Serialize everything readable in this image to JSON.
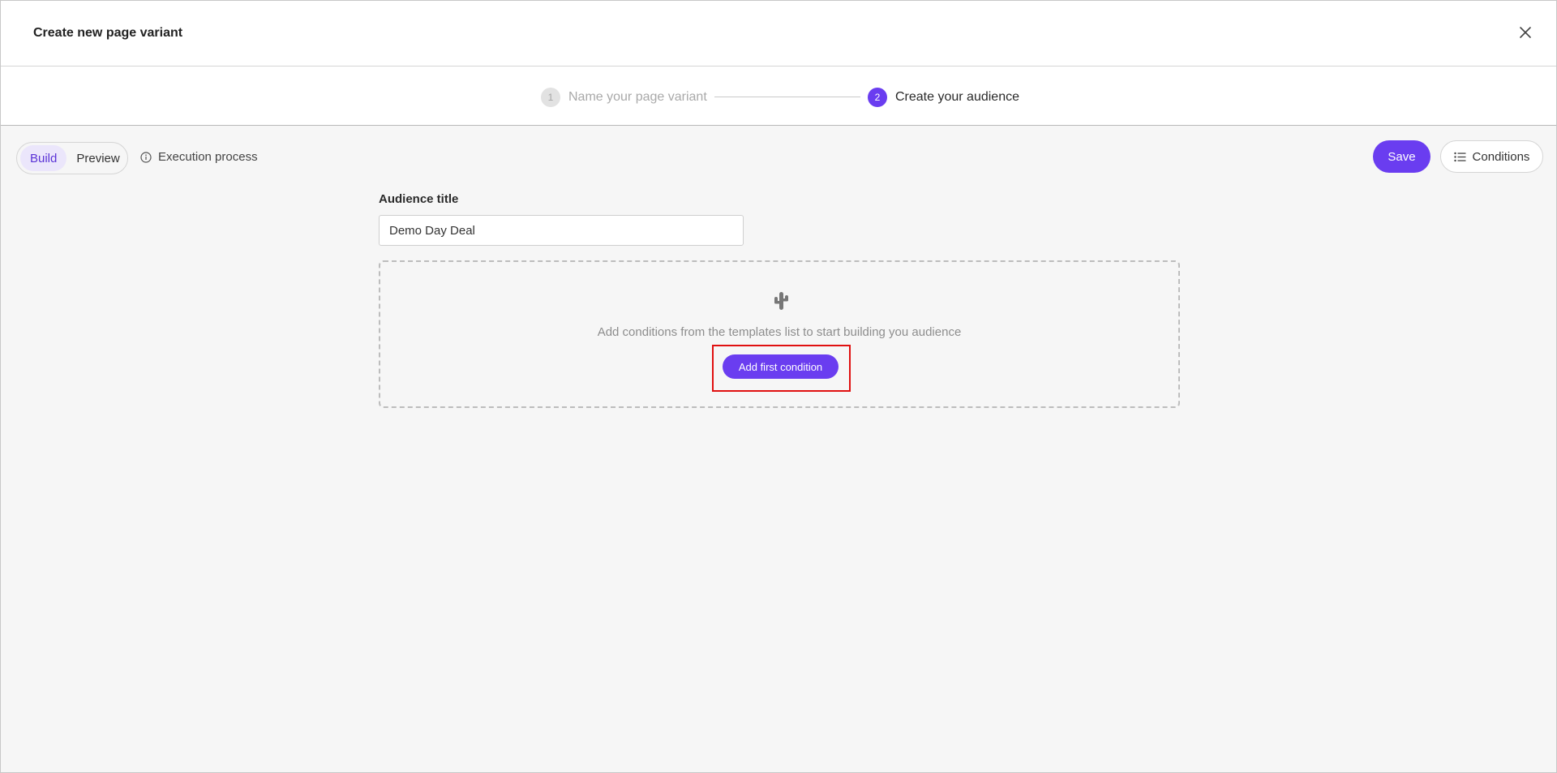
{
  "header": {
    "title": "Create new page variant"
  },
  "stepper": {
    "steps": [
      {
        "number": "1",
        "label": "Name your page variant"
      },
      {
        "number": "2",
        "label": "Create your audience"
      }
    ]
  },
  "toolbar": {
    "tabs": [
      {
        "label": "Build",
        "active": true
      },
      {
        "label": "Preview",
        "active": false
      }
    ],
    "execution_label": "Execution process",
    "save_label": "Save",
    "conditions_label": "Conditions"
  },
  "audience": {
    "title_label": "Audience title",
    "title_value": "Demo Day Deal"
  },
  "empty_state": {
    "icon": "cactus-icon",
    "message": "Add conditions from the templates list to start building you audience",
    "button_label": "Add first condition"
  },
  "colors": {
    "accent": "#6a3df0",
    "highlight": "#e01010"
  }
}
